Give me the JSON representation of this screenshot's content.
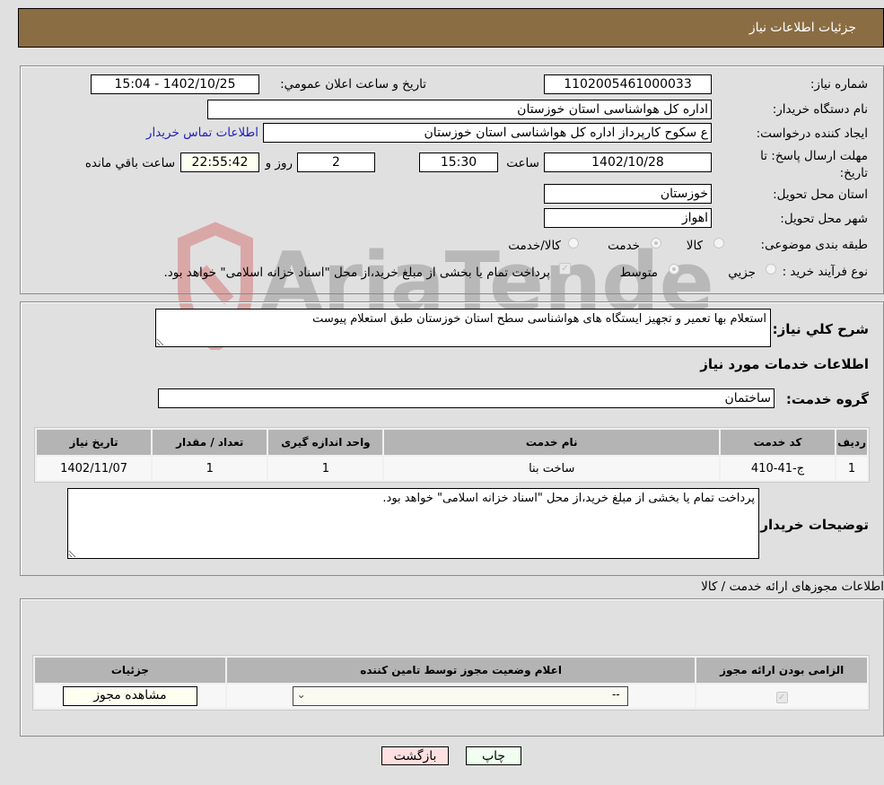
{
  "header": {
    "title": "جزئیات اطلاعات نیاز"
  },
  "form": {
    "need_number": {
      "label": "شماره نیاز:",
      "value": "1102005461000033"
    },
    "announce_datetime": {
      "label": "تاریخ و ساعت اعلان عمومي:",
      "value": "1402/10/25 - 15:04"
    },
    "buyer_org": {
      "label": "نام دستگاه خريدار:",
      "value": "اداره کل هواشناسی استان خوزستان"
    },
    "requester": {
      "label": "ایجاد کننده درخواست:",
      "value": "ع سکوح کارپرداز اداره کل هواشناسی استان خوزستان"
    },
    "buyer_contact_link": "اطلاعات تماس خريدار",
    "deadline": {
      "label": "مهلت ارسال پاسخ: تا تاریخ:",
      "date": "1402/10/28",
      "time_label": "ساعت",
      "time": "15:30",
      "days": "2",
      "days_label": "روز و",
      "remaining": "22:55:42",
      "remaining_label": "ساعت باقي مانده"
    },
    "province": {
      "label": "استان محل تحویل:",
      "value": "خوزستان"
    },
    "city": {
      "label": "شهر محل تحویل:",
      "value": "اهواز"
    },
    "category": {
      "label": "طبقه بندی موضوعی:",
      "options": [
        {
          "label": "کالا",
          "selected": false
        },
        {
          "label": "خدمت",
          "selected": true
        },
        {
          "label": "کالا/خدمت",
          "selected": false
        }
      ]
    },
    "process_type": {
      "label": "نوع فرآیند خرید :",
      "options": [
        {
          "label": "جزيي",
          "selected": false
        },
        {
          "label": "متوسط",
          "selected": true
        }
      ],
      "payment_note": "پرداخت تمام یا بخشی از مبلغ خرید،از محل \"اسناد خزانه اسلامی\" خواهد بود.",
      "payment_checked": true
    }
  },
  "description": {
    "label": "شرح کلي نياز:",
    "value": "استعلام بها تعمیر و تجهیز ایستگاه های هواشناسی سطح استان خوزستان طبق استعلام پیوست"
  },
  "services": {
    "section_title": "اطلاعات خدمات مورد نیاز",
    "group_label": "گروه خدمت:",
    "group_value": "ساختمان",
    "table": {
      "headers": [
        "رديف",
        "کد خدمت",
        "نام خدمت",
        "واحد اندازه گیری",
        "تعداد / مقدار",
        "تاريخ نياز"
      ],
      "rows": [
        [
          "1",
          "ج-41-410",
          "ساخت بنا",
          "1",
          "1",
          "1402/11/07"
        ]
      ]
    }
  },
  "buyer_notes": {
    "label": "توضیحات خریدار:",
    "value": "پرداخت تمام یا بخشی از مبلغ خرید،از محل \"اسناد خزانه اسلامی\" خواهد بود."
  },
  "permits": {
    "section_title": "اطلاعات مجوزهای ارائه خدمت / کالا",
    "headers": [
      "الزامی بودن ارائه مجوز",
      "اعلام وضعیت مجوز توسط تامین کننده",
      "جزئیات"
    ],
    "rows": [
      {
        "required": true,
        "status": "--",
        "details_button": "مشاهده مجوز"
      }
    ]
  },
  "actions": {
    "print": "چاپ",
    "back": "بازگشت"
  },
  "colors": {
    "header_bg": "#8b6d43",
    "back_bg": "#ffe0e0",
    "print_bg": "#f0fff0",
    "link": "#2020c0"
  }
}
